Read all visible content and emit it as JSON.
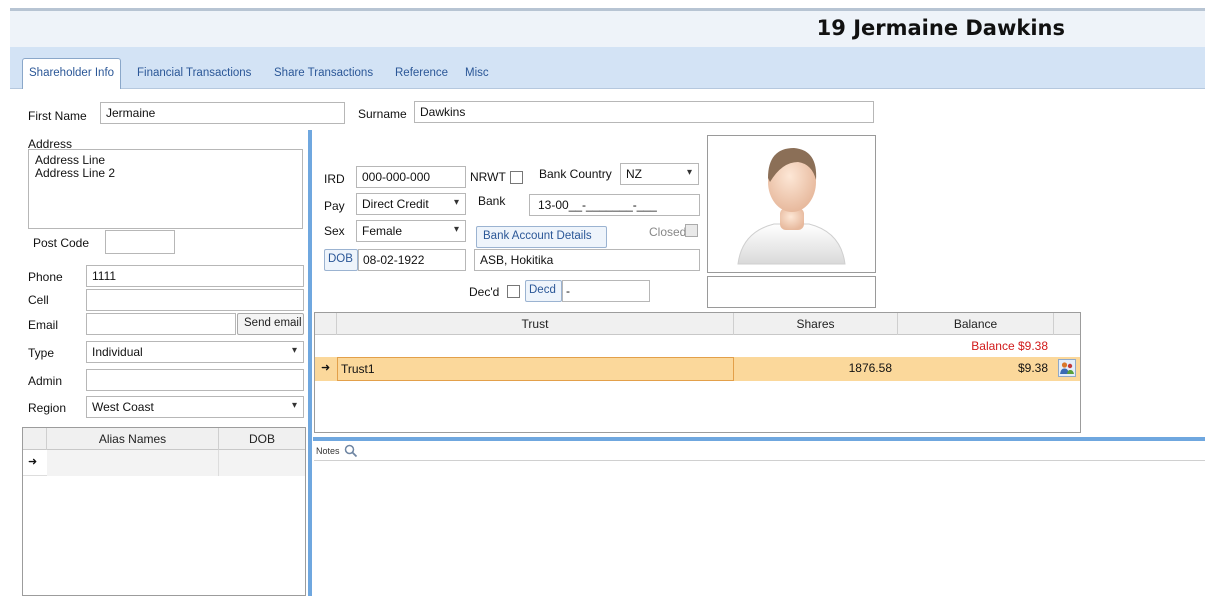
{
  "header": {
    "title": "19  Jermaine Dawkins"
  },
  "tabs": [
    "Shareholder Info",
    "Financial Transactions",
    "Share Transactions",
    "Reference",
    "Misc"
  ],
  "form": {
    "first_name_label": "First Name",
    "first_name": "Jermaine",
    "surname_label": "Surname",
    "surname": "Dawkins",
    "address_label": "Address",
    "address_line1": "Address Line",
    "address_line2": "Address Line 2",
    "postcode_label": "Post Code",
    "postcode": "",
    "phone_label": "Phone",
    "phone": "1111",
    "cell_label": "Cell",
    "cell": "",
    "email_label": "Email",
    "email": "",
    "send_email": "Send email",
    "type_label": "Type",
    "type": "Individual",
    "admin_label": "Admin",
    "admin": "",
    "region_label": "Region",
    "region": "West Coast",
    "ird_label": "IRD",
    "ird": "000-000-000",
    "nrwt_label": "NRWT",
    "bank_country_label": "Bank Country",
    "bank_country": "NZ",
    "pay_label": "Pay",
    "pay": "Direct Credit",
    "bank_label": "Bank",
    "bank": "13-00__-_______-___",
    "sex_label": "Sex",
    "sex": "Female",
    "bank_account_details": "Bank Account Details",
    "closed_label": "Closed",
    "dob_button": "DOB",
    "dob": "08-02-1922",
    "branch": "ASB, Hokitika",
    "decd_label": "Dec'd",
    "decd_button": "Decd",
    "decd_value": "-"
  },
  "alias_grid": {
    "columns": [
      "Alias Names",
      "DOB"
    ]
  },
  "trust_grid": {
    "columns": [
      "Trust",
      "Shares",
      "Balance"
    ],
    "summary": "Balance  $9.38",
    "rows": [
      {
        "trust": "Trust1",
        "shares": "1876.58",
        "balance": "$9.38"
      }
    ]
  },
  "notes": {
    "label": "Notes"
  },
  "colors": {
    "accent": "#6fa7df",
    "highlight": "#fbd89b",
    "balance_red": "#d11a1a"
  }
}
